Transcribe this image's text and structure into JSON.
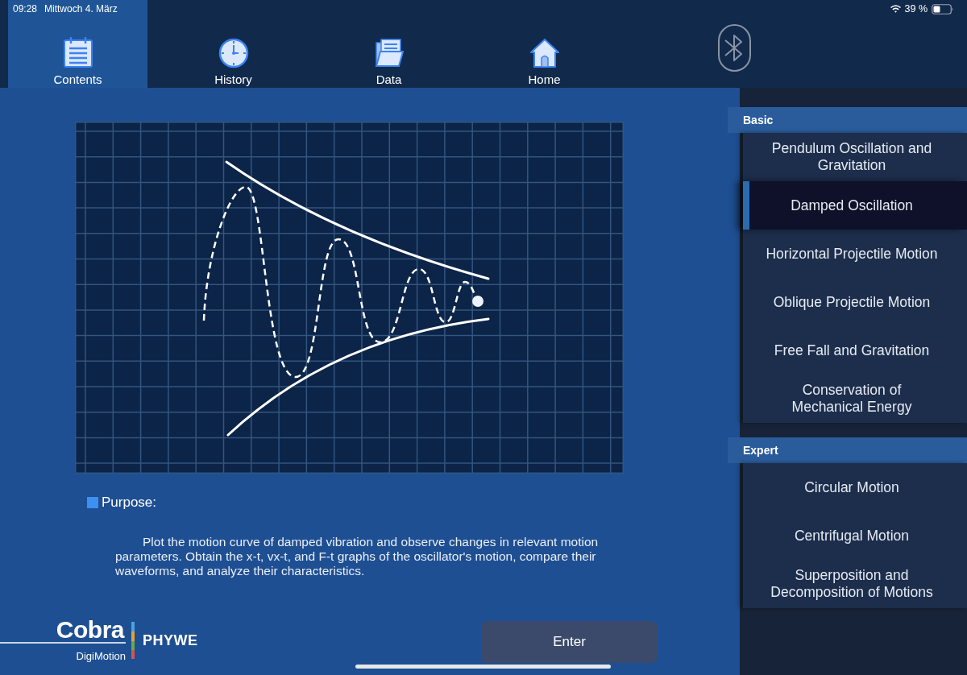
{
  "status_bar": {
    "time": "09:28",
    "date": "Mittwoch 4. März",
    "battery_percent": "39 %"
  },
  "tabs": [
    {
      "label": "Contents",
      "selected": true
    },
    {
      "label": "History",
      "selected": false
    },
    {
      "label": "Data",
      "selected": false
    },
    {
      "label": "Home",
      "selected": false
    }
  ],
  "purpose": {
    "heading": "Purpose:",
    "text": "Plot the motion curve of damped vibration and observe changes in relevant motion parameters. Obtain the x-t, vx-t, and F-t graphs of the oscillator's motion, compare their waveforms, and analyze their characteristics."
  },
  "logo": {
    "brand": "Cobra",
    "product": "DigiMotion",
    "maker": "PHYWE"
  },
  "enter_button": {
    "label": "Enter"
  },
  "sidebar": {
    "sections": [
      {
        "title": "Basic",
        "items": [
          {
            "label": "Pendulum Oscillation and Gravitation",
            "selected": false
          },
          {
            "label": "Damped Oscillation",
            "selected": true
          },
          {
            "label": "Horizontal Projectile Motion",
            "selected": false
          },
          {
            "label": "Oblique Projectile Motion",
            "selected": false
          },
          {
            "label": "Free Fall and Gravitation",
            "selected": false
          },
          {
            "label": "Conservation of Mechanical Energy",
            "selected": false
          }
        ]
      },
      {
        "title": "Expert",
        "items": [
          {
            "label": "Circular Motion",
            "selected": false
          },
          {
            "label": "Centrifugal Motion",
            "selected": false
          },
          {
            "label": "Superposition and Decomposition of Motions",
            "selected": false
          }
        ]
      }
    ]
  }
}
